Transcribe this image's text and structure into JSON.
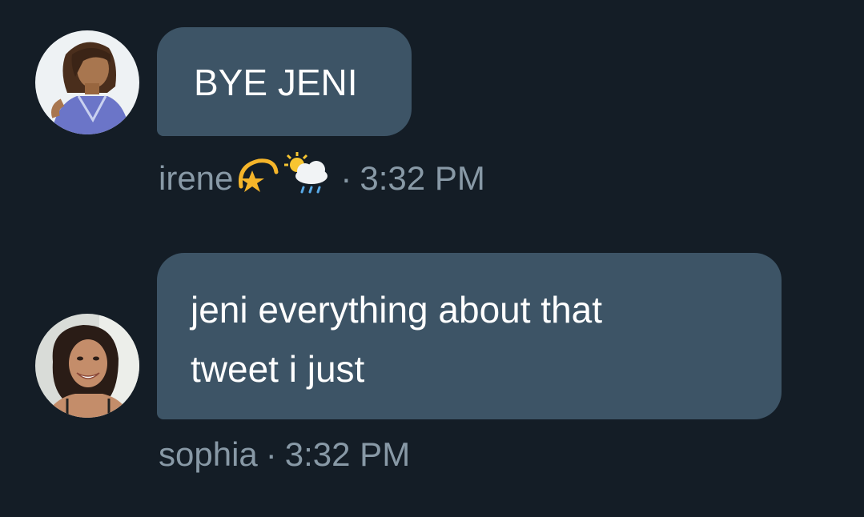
{
  "messages": [
    {
      "sender": "irene",
      "text": "BYE JENI",
      "time": "3:32 PM",
      "separator": "·",
      "name_emojis": [
        "dizzy-star-emoji",
        "sun-rain-cloud-emoji"
      ],
      "avatar": "cartoon-character-avatar"
    },
    {
      "sender": "sophia",
      "lines": [
        "jeni everything about that",
        "tweet i just"
      ],
      "time": "3:32 PM",
      "separator": "·",
      "avatar": "smiling-woman-photo-avatar"
    }
  ],
  "colors": {
    "background": "#141d26",
    "bubble": "#3d5466",
    "text": "#ffffff",
    "meta": "#8899a6"
  }
}
